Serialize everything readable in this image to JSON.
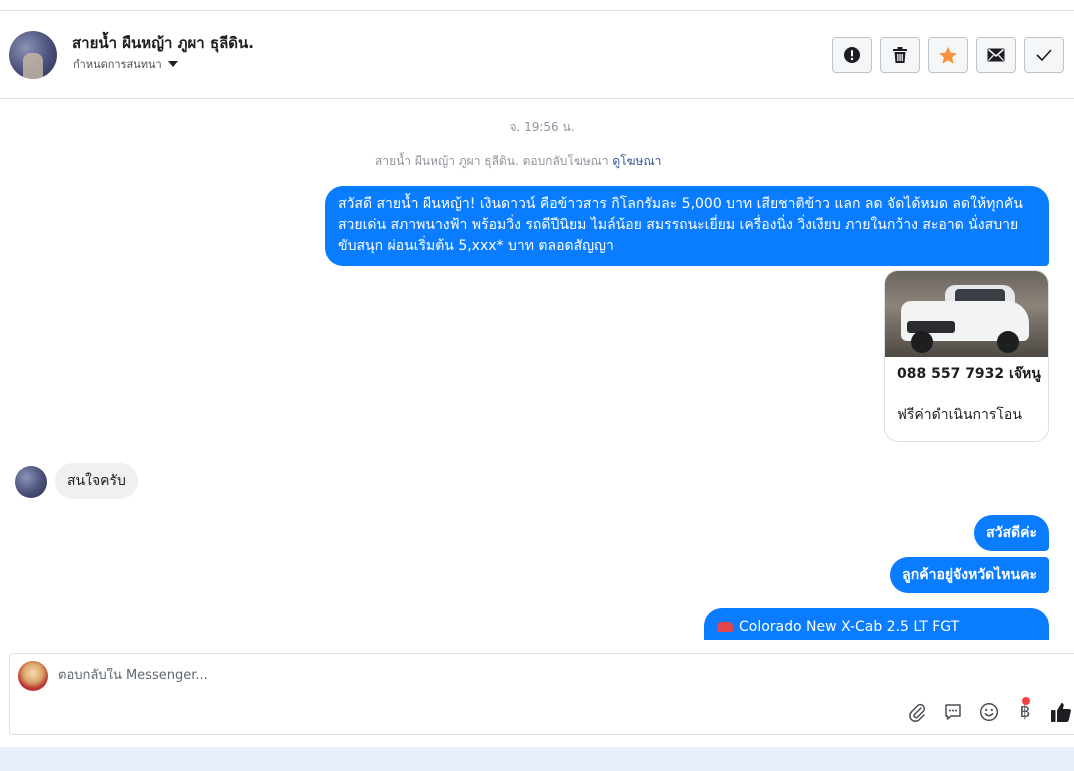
{
  "header": {
    "contact_name": "สายน้ำ ผืนหญ้า ภูผา ธุลีดิน.",
    "assign_label": "กำหนดการสนทนา",
    "actions": [
      {
        "name": "spam-button",
        "icon": "exclamation-circle-icon"
      },
      {
        "name": "delete-button",
        "icon": "trash-icon"
      },
      {
        "name": "star-button",
        "icon": "star-icon",
        "color": "#f7923b"
      },
      {
        "name": "mark-unread-button",
        "icon": "envelope-icon"
      },
      {
        "name": "mark-done-button",
        "icon": "checkmark-icon"
      }
    ]
  },
  "thread": {
    "timestamp": "จ. 19:56 น.",
    "ad_reply_note": "สายน้ำ ผืนหญ้า ภูผา ธุลีดิน. ตอบกลับโฆษณา",
    "ad_link": "ดูโฆษณา",
    "messages": [
      {
        "from": "page",
        "text": "สวัสดี สายน้ำ ผืนหญ้า! เงินดาวน์ คือข้าวสาร กิโลกรัมละ 5,000 บาท เสียชาติข้าว แลก ลด จัดได้หมด ลดให้ทุกคัน สวยเด่น สภาพนางฟ้า พร้อมวิ่ง รถดีปีนิยม ไมล์น้อย สมรรถนะเยี่ยม เครื่องนิ่ง วิ่งเงียบ ภายในกว้าง สะอาด นั่งสบายขับสนุก ผ่อนเริ่มต้น 5,xxx* บาท ตลอดสัญญา"
      },
      {
        "from": "page",
        "type": "card",
        "phone": "088 557 7932 เจ๊หนู",
        "subtitle": "ฟรีค่าดำเนินการโอน"
      },
      {
        "from": "customer",
        "text": "สนใจครับ"
      },
      {
        "from": "page",
        "text": "สวัสดีค่ะ"
      },
      {
        "from": "page",
        "text": "ลูกค้าอยู่จังหวัดไหนคะ"
      },
      {
        "from": "page",
        "text": "Colorado New X-Cab 2.5 LT FGT",
        "icon": "car-emoji-icon"
      }
    ]
  },
  "composer": {
    "placeholder": "ตอบกลับใน Messenger...",
    "baht_symbol": "฿",
    "icons": [
      "paperclip-icon",
      "saved-reply-icon",
      "emoji-icon",
      "baht-icon",
      "thumbs-up-icon"
    ]
  },
  "colors": {
    "accent_blue": "#0a7cff",
    "incoming_bubble": "#f1f0f0",
    "star_orange": "#f7923b",
    "notification_red": "#fa3e3e"
  }
}
